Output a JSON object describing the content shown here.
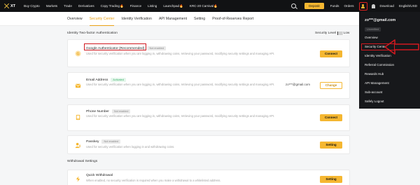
{
  "topnav": {
    "logo": "XT",
    "items": [
      "Buy Crypto",
      "Markets",
      "Trade",
      "Derivatives",
      "Copy Trading🔥",
      "Finance",
      "Listing",
      "Launchpad🔥",
      "KRC-20 Carnival🔥"
    ],
    "deposit": "Deposit",
    "funds": "Funds",
    "orders": "Orders",
    "download": "Download",
    "lang": "English/USD"
  },
  "subnav": {
    "tabs": [
      "Overview",
      "Security Center",
      "Identity Verification",
      "API Management",
      "Setting",
      "Proof-of-Reserves Report"
    ],
    "active": "Security Center"
  },
  "main": {
    "section_2fa": "Identity Two-factor Authentication",
    "security_level_label": "Security Level",
    "security_level_value": "Low",
    "withdrawal_section": "Withdrawal Settings",
    "cards": [
      {
        "title": "Google Authenticator (Recommended)",
        "badge": "Not enabled",
        "desc": "Used for security verification when you are logging in, withdrawing coins, retrieving your password, modifying security settings and managing API.",
        "button": "Connect"
      },
      {
        "title": "Email Address",
        "badge": "Activated",
        "desc": "Used for security verification when you are logging in, withdrawing coins, retrieving your password, modifying security settings and managing API.",
        "masked": "zo***@gmail.com",
        "button": "Change"
      },
      {
        "title": "Phone Number",
        "badge": "Not enabled",
        "desc": "Used for security verification when you are logging in, withdrawing coins, retrieving your password, modifying security settings and managing API.",
        "button": "Connect"
      },
      {
        "title": "Passkey",
        "badge": "Not enabled",
        "desc": "Used for security verification when logging in and withdrawing coins.",
        "button": "Setting"
      },
      {
        "title": "Quick Withdrawal",
        "desc": "When enabled, no security verification is required when you make a withdrawal to a whitelisted address.",
        "button": "Setting"
      }
    ]
  },
  "dropdown": {
    "email": "zo***@gmail.com",
    "status": "Unverified",
    "items": [
      "Overview",
      "Security Center",
      "Identity Verification",
      "Referral Commission",
      "Rewards Hub",
      "API Management",
      "Sub-account",
      "Safely Logout"
    ]
  },
  "colors": {
    "accent": "#f5b731",
    "highlight": "#d0181f",
    "nav_bg": "#111214"
  }
}
